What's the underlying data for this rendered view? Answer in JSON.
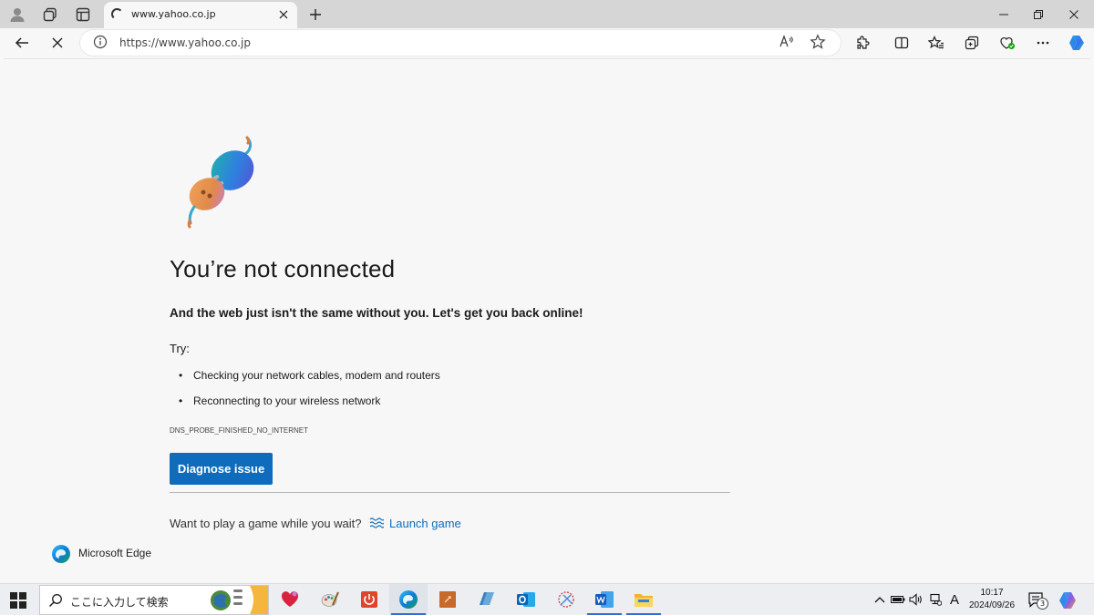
{
  "window": {
    "tab_title": "www.yahoo.co.jp",
    "address_url": "https://www.yahoo.co.jp"
  },
  "content": {
    "heading": "You’re not connected",
    "subheading": "And the web just isn't the same without you. Let's get you back online!",
    "try_label": "Try:",
    "suggestions": [
      "Checking your network cables, modem and routers",
      "Reconnecting to your wireless network"
    ],
    "error_code": "DNS_PROBE_FINISHED_NO_INTERNET",
    "diagnose_label": "Diagnose issue",
    "game_prompt": "Want to play a game while you wait?",
    "game_link": "Launch game",
    "brand_name": "Microsoft Edge"
  },
  "taskbar": {
    "search_placeholder": "ここに入力して検索",
    "time": "10:17",
    "date": "2024/09/26",
    "notification_count": "3",
    "ime_label": "A",
    "apps": [
      "app-red-heart",
      "app-paint",
      "app-power-red",
      "app-edge",
      "app-orange",
      "app-blue-tile",
      "app-outlook",
      "app-snipping",
      "app-word",
      "app-file-explorer"
    ]
  },
  "colors": {
    "accent": "#0f6cbd",
    "tabstrip": "#d6d6d6",
    "page_bg": "#f7f7f7"
  },
  "icons": {
    "toolbar": [
      "back-arrow-icon",
      "stop-loading-icon",
      "site-info-icon",
      "read-aloud-icon",
      "favorite-star-icon",
      "extensions-icon",
      "split-screen-icon",
      "favorites-icon",
      "collections-icon",
      "browser-essentials-icon",
      "more-icon",
      "copilot-icon"
    ]
  }
}
